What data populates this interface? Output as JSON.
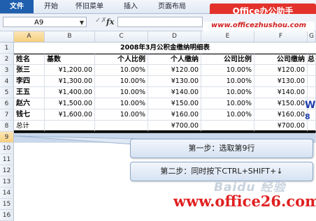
{
  "ribbon": {
    "tabs": [
      "文件",
      "开始",
      "怀旧菜单",
      "插入",
      "页面布局"
    ],
    "brand": "Office办公助手",
    "brand_url": "www.officezhushou.com"
  },
  "formula_bar": {
    "name_box": "A9",
    "fx": "fx",
    "cancel_glyph": "✓✗",
    "dropdown": "▼"
  },
  "columns": [
    "A",
    "B",
    "C",
    "D",
    "E",
    "F",
    "G"
  ],
  "row_numbers": [
    "1",
    "2",
    "3",
    "4",
    "5",
    "6",
    "7",
    "8",
    "9",
    "10",
    "11",
    "12",
    "13",
    "14",
    "15",
    "16"
  ],
  "sheet": {
    "title": "2008年3月公积金缴纳明细表",
    "headers": [
      "姓名",
      "基数",
      "个人比例",
      "个人缴纳",
      "公司比例",
      "公司缴纳",
      "总"
    ],
    "rows": [
      [
        "张三",
        "¥1,200.00",
        "10.00%",
        "¥120.00",
        "10.00%",
        "¥120.00"
      ],
      [
        "李四",
        "¥1,300.00",
        "10.00%",
        "¥130.00",
        "10.00%",
        "¥130.00"
      ],
      [
        "王五",
        "¥1,400.00",
        "10.00%",
        "¥140.00",
        "10.00%",
        "¥140.00"
      ],
      [
        "赵六",
        "¥1,500.00",
        "10.00%",
        "¥150.00",
        "10.00%",
        "¥150.00"
      ],
      [
        "钱七",
        "¥1,600.00",
        "10.00%",
        "¥160.00",
        "10.00%",
        "¥160.00"
      ]
    ],
    "total": {
      "label": "总计",
      "personal": "¥700.00",
      "company": "¥700.00"
    }
  },
  "watermark_glyphs": [
    "W",
    "8"
  ],
  "callouts": {
    "step1": "第一步：选取第9行",
    "step2": "第二步：同时按下CTRL+SHIFT+↓"
  },
  "footer": {
    "baidu": "Baidu 经验",
    "site": "www.office26.com"
  },
  "colors": {
    "file_tab": "#1f5fae",
    "brand_bg": "#e3322c",
    "selection": "#c9d8ec",
    "site_text": "#e02020"
  }
}
